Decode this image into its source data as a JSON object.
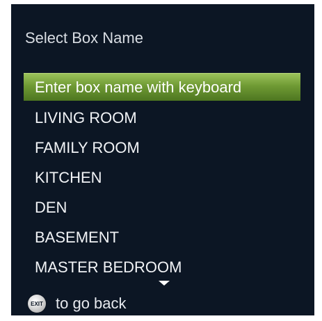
{
  "dialog": {
    "title": "Select Box Name"
  },
  "menu": {
    "items": [
      {
        "label": "Enter box name with keyboard",
        "selected": true
      },
      {
        "label": "LIVING ROOM",
        "selected": false
      },
      {
        "label": "FAMILY ROOM",
        "selected": false
      },
      {
        "label": "KITCHEN",
        "selected": false
      },
      {
        "label": "DEN",
        "selected": false
      },
      {
        "label": "BASEMENT",
        "selected": false
      },
      {
        "label": "MASTER BEDROOM",
        "selected": false
      }
    ],
    "more_indicator_icon": "triangle-down-icon"
  },
  "footer": {
    "exit_icon": "exit-button-icon",
    "exit_icon_label": "EXIT",
    "text": "to go back"
  },
  "colors": {
    "panel_background": "#0c1624",
    "highlight": "#6f9a34",
    "text": "#f1f3f6"
  }
}
